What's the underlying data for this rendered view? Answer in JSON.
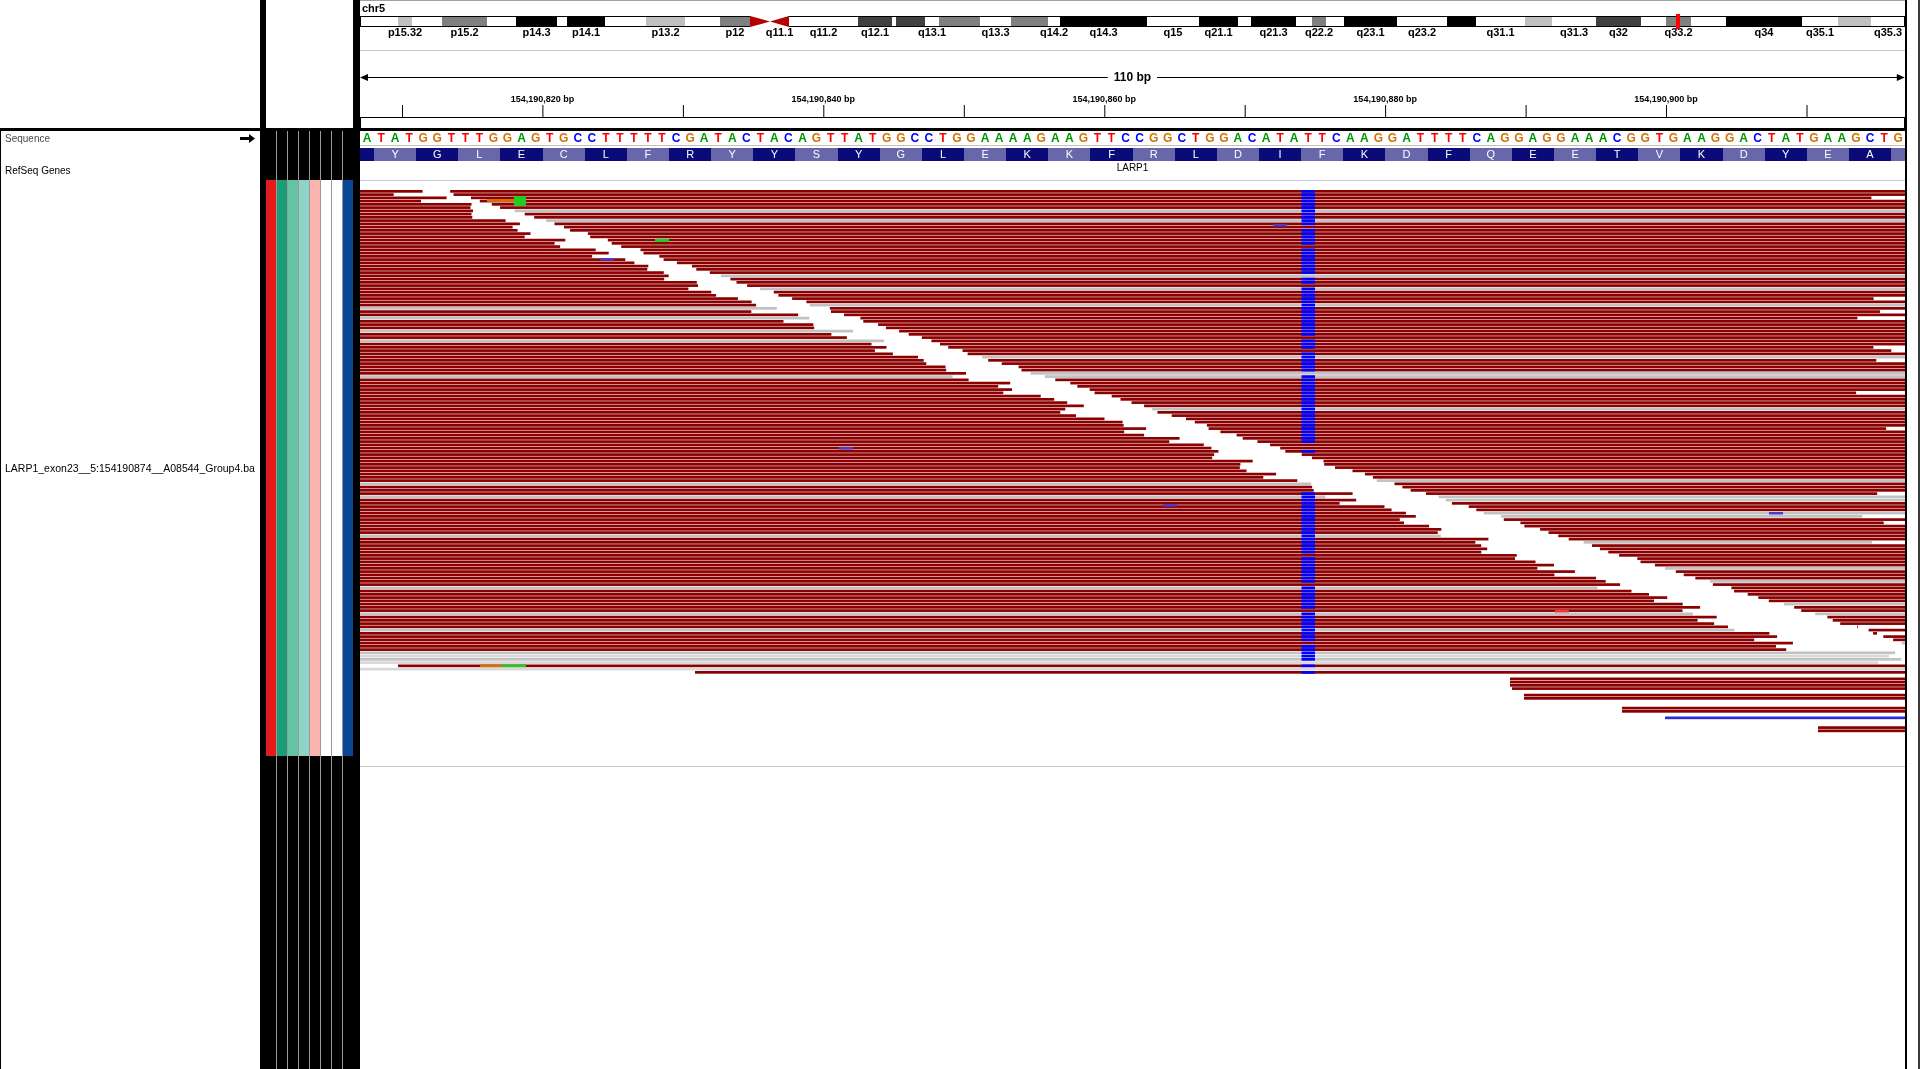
{
  "ideogram": {
    "chromosome": "chr5",
    "bands": [
      {
        "kind": "band",
        "color": "#ffffff",
        "in_view": false
      },
      {
        "kind": "band",
        "label": "p15.32",
        "color": "#c0c0c0",
        "in_view": false
      },
      {
        "kind": "band",
        "color": "#ffffff",
        "in_view": false
      },
      {
        "kind": "band",
        "label": "p15.2",
        "color": "#808080",
        "in_view": false
      },
      {
        "kind": "band",
        "color": "#ffffff",
        "in_view": false
      },
      {
        "kind": "band",
        "label": "p14.3",
        "color": "#000000",
        "in_view": false
      },
      {
        "kind": "band",
        "color": "#ffffff",
        "in_view": false
      },
      {
        "kind": "band",
        "label": "p14.1",
        "color": "#000000",
        "in_view": false
      },
      {
        "kind": "band",
        "color": "#ffffff",
        "in_view": false
      },
      {
        "kind": "band",
        "label": "p13.2",
        "color": "#c0c0c0",
        "in_view": false
      },
      {
        "kind": "band",
        "color": "#ffffff",
        "in_view": false
      },
      {
        "kind": "band",
        "label": "p12",
        "color": "#808080",
        "in_view": false
      },
      {
        "kind": "centromere",
        "color": "#b40000",
        "in_view": false
      },
      {
        "kind": "centromere",
        "label": "q11.1",
        "color": "#b40000",
        "in_view": false
      },
      {
        "kind": "band",
        "label": "q11.2",
        "color": "#ffffff",
        "in_view": false
      },
      {
        "kind": "band",
        "label": "q12.1",
        "color": "#404040",
        "in_view": false
      },
      {
        "kind": "band",
        "color": "#ffffff",
        "in_view": false
      },
      {
        "kind": "band",
        "color": "#404040",
        "in_view": false
      },
      {
        "kind": "band",
        "label": "q13.1",
        "color": "#ffffff",
        "in_view": false
      },
      {
        "kind": "band",
        "color": "#808080",
        "in_view": false
      },
      {
        "kind": "band",
        "label": "q13.3",
        "color": "#ffffff",
        "in_view": false
      },
      {
        "kind": "band",
        "color": "#808080",
        "in_view": false
      },
      {
        "kind": "band",
        "label": "q14.2",
        "color": "#ffffff",
        "in_view": false
      },
      {
        "kind": "band",
        "label": "q14.3",
        "color": "#000000",
        "in_view": false
      },
      {
        "kind": "band",
        "label": "q15",
        "color": "#ffffff",
        "in_view": false
      },
      {
        "kind": "band",
        "label": "q21.1",
        "color": "#000000",
        "in_view": false
      },
      {
        "kind": "band",
        "color": "#ffffff",
        "in_view": false
      },
      {
        "kind": "band",
        "label": "q21.3",
        "color": "#000000",
        "in_view": false
      },
      {
        "kind": "band",
        "color": "#ffffff",
        "in_view": false
      },
      {
        "kind": "band",
        "label": "q22.2",
        "color": "#808080",
        "in_view": false
      },
      {
        "kind": "band",
        "color": "#ffffff",
        "in_view": false
      },
      {
        "kind": "band",
        "label": "q23.1",
        "color": "#000000",
        "in_view": false
      },
      {
        "kind": "band",
        "label": "q23.2",
        "color": "#ffffff",
        "in_view": false
      },
      {
        "kind": "band",
        "color": "#000000",
        "in_view": false
      },
      {
        "kind": "band",
        "label": "q31.1",
        "color": "#ffffff",
        "in_view": false
      },
      {
        "kind": "band",
        "color": "#c0c0c0",
        "in_view": false
      },
      {
        "kind": "band",
        "label": "q31.3",
        "color": "#ffffff",
        "in_view": false
      },
      {
        "kind": "band",
        "label": "q32",
        "color": "#404040",
        "in_view": false
      },
      {
        "kind": "band",
        "color": "#ffffff",
        "in_view": false
      },
      {
        "kind": "band",
        "label": "q33.2",
        "color": "#808080",
        "in_view": true
      },
      {
        "kind": "band",
        "color": "#ffffff",
        "in_view": false
      },
      {
        "kind": "band",
        "label": "q34",
        "color": "#000000",
        "in_view": false
      },
      {
        "kind": "band",
        "label": "q35.1",
        "color": "#ffffff",
        "in_view": false
      },
      {
        "kind": "band",
        "color": "#c0c0c0",
        "in_view": false
      },
      {
        "kind": "band",
        "label": "q35.3",
        "color": "#ffffff",
        "in_view": false
      }
    ]
  },
  "ruler": {
    "span": "110 bp",
    "tick_labels": [
      "154,190,820 bp",
      "154,190,840 bp",
      "154,190,860 bp",
      "154,190,880 bp",
      "154,190,900 bp"
    ]
  },
  "tracks": [
    {
      "kind": "sequence",
      "name": "Sequence",
      "bases": [
        {
          "base": "A",
          "color": "#009600"
        },
        {
          "base": "T",
          "color": "#ff0000"
        },
        {
          "base": "A",
          "color": "#009600"
        },
        {
          "base": "T",
          "color": "#ff0000"
        },
        {
          "base": "G",
          "color": "#d17105"
        },
        {
          "base": "G",
          "color": "#d17105"
        },
        {
          "base": "T",
          "color": "#ff0000"
        },
        {
          "base": "T",
          "color": "#ff0000"
        },
        {
          "base": "T",
          "color": "#ff0000"
        },
        {
          "base": "G",
          "color": "#d17105"
        },
        {
          "base": "G",
          "color": "#d17105"
        },
        {
          "base": "A",
          "color": "#009600"
        },
        {
          "base": "G",
          "color": "#d17105"
        },
        {
          "base": "T",
          "color": "#ff0000"
        },
        {
          "base": "G",
          "color": "#d17105"
        },
        {
          "base": "C",
          "color": "#0000ff"
        },
        {
          "base": "C",
          "color": "#0000ff"
        },
        {
          "base": "T",
          "color": "#ff0000"
        },
        {
          "base": "T",
          "color": "#ff0000"
        },
        {
          "base": "T",
          "color": "#ff0000"
        },
        {
          "base": "T",
          "color": "#ff0000"
        },
        {
          "base": "T",
          "color": "#ff0000"
        },
        {
          "base": "C",
          "color": "#0000ff"
        },
        {
          "base": "G",
          "color": "#d17105"
        },
        {
          "base": "A",
          "color": "#009600"
        },
        {
          "base": "T",
          "color": "#ff0000"
        },
        {
          "base": "A",
          "color": "#009600"
        },
        {
          "base": "C",
          "color": "#0000ff"
        },
        {
          "base": "T",
          "color": "#ff0000"
        },
        {
          "base": "A",
          "color": "#009600"
        },
        {
          "base": "C",
          "color": "#0000ff"
        },
        {
          "base": "A",
          "color": "#009600"
        },
        {
          "base": "G",
          "color": "#d17105"
        },
        {
          "base": "T",
          "color": "#ff0000"
        },
        {
          "base": "T",
          "color": "#ff0000"
        },
        {
          "base": "A",
          "color": "#009600"
        },
        {
          "base": "T",
          "color": "#ff0000"
        },
        {
          "base": "G",
          "color": "#d17105"
        },
        {
          "base": "G",
          "color": "#d17105"
        },
        {
          "base": "C",
          "color": "#0000ff"
        },
        {
          "base": "C",
          "color": "#0000ff"
        },
        {
          "base": "T",
          "color": "#ff0000"
        },
        {
          "base": "G",
          "color": "#d17105"
        },
        {
          "base": "G",
          "color": "#d17105"
        },
        {
          "base": "A",
          "color": "#009600"
        },
        {
          "base": "A",
          "color": "#009600"
        },
        {
          "base": "A",
          "color": "#009600"
        },
        {
          "base": "A",
          "color": "#009600"
        },
        {
          "base": "G",
          "color": "#d17105"
        },
        {
          "base": "A",
          "color": "#009600"
        },
        {
          "base": "A",
          "color": "#009600"
        },
        {
          "base": "G",
          "color": "#d17105"
        },
        {
          "base": "T",
          "color": "#ff0000"
        },
        {
          "base": "T",
          "color": "#ff0000"
        },
        {
          "base": "C",
          "color": "#0000ff"
        },
        {
          "base": "C",
          "color": "#0000ff"
        },
        {
          "base": "G",
          "color": "#d17105"
        },
        {
          "base": "G",
          "color": "#d17105"
        },
        {
          "base": "C",
          "color": "#0000ff"
        },
        {
          "base": "T",
          "color": "#ff0000"
        },
        {
          "base": "G",
          "color": "#d17105"
        },
        {
          "base": "G",
          "color": "#d17105"
        },
        {
          "base": "A",
          "color": "#009600"
        },
        {
          "base": "C",
          "color": "#0000ff"
        },
        {
          "base": "A",
          "color": "#009600"
        },
        {
          "base": "T",
          "color": "#ff0000"
        },
        {
          "base": "A",
          "color": "#009600"
        },
        {
          "base": "T",
          "color": "#ff0000"
        },
        {
          "base": "T",
          "color": "#ff0000"
        },
        {
          "base": "C",
          "color": "#0000ff"
        },
        {
          "base": "A",
          "color": "#009600"
        },
        {
          "base": "A",
          "color": "#009600"
        },
        {
          "base": "G",
          "color": "#d17105"
        },
        {
          "base": "G",
          "color": "#d17105"
        },
        {
          "base": "A",
          "color": "#009600"
        },
        {
          "base": "T",
          "color": "#ff0000"
        },
        {
          "base": "T",
          "color": "#ff0000"
        },
        {
          "base": "T",
          "color": "#ff0000"
        },
        {
          "base": "T",
          "color": "#ff0000"
        },
        {
          "base": "C",
          "color": "#0000ff"
        },
        {
          "base": "A",
          "color": "#009600"
        },
        {
          "base": "G",
          "color": "#d17105"
        },
        {
          "base": "G",
          "color": "#d17105"
        },
        {
          "base": "A",
          "color": "#009600"
        },
        {
          "base": "G",
          "color": "#d17105"
        },
        {
          "base": "G",
          "color": "#d17105"
        },
        {
          "base": "A",
          "color": "#009600"
        },
        {
          "base": "A",
          "color": "#009600"
        },
        {
          "base": "A",
          "color": "#009600"
        },
        {
          "base": "C",
          "color": "#0000ff"
        },
        {
          "base": "G",
          "color": "#d17105"
        },
        {
          "base": "G",
          "color": "#d17105"
        },
        {
          "base": "T",
          "color": "#ff0000"
        },
        {
          "base": "G",
          "color": "#d17105"
        },
        {
          "base": "A",
          "color": "#009600"
        },
        {
          "base": "A",
          "color": "#009600"
        },
        {
          "base": "G",
          "color": "#d17105"
        },
        {
          "base": "G",
          "color": "#d17105"
        },
        {
          "base": "A",
          "color": "#009600"
        },
        {
          "base": "C",
          "color": "#0000ff"
        },
        {
          "base": "T",
          "color": "#ff0000"
        },
        {
          "base": "A",
          "color": "#009600"
        },
        {
          "base": "T",
          "color": "#ff0000"
        },
        {
          "base": "G",
          "color": "#d17105"
        },
        {
          "base": "A",
          "color": "#009600"
        },
        {
          "base": "A",
          "color": "#009600"
        },
        {
          "base": "G",
          "color": "#d17105"
        },
        {
          "base": "C",
          "color": "#0000ff"
        },
        {
          "base": "T",
          "color": "#ff0000"
        },
        {
          "base": "G",
          "color": "#d17105"
        }
      ]
    },
    {
      "kind": "gene",
      "name": "RefSeq Genes",
      "gene": "LARP1",
      "amino_acids": [
        "Y",
        "G",
        "L",
        "E",
        "C",
        "L",
        "F",
        "R",
        "Y",
        "Y",
        "S",
        "Y",
        "G",
        "L",
        "E",
        "K",
        "K",
        "F",
        "R",
        "L",
        "D",
        "I",
        "F",
        "K",
        "D",
        "F",
        "Q",
        "E",
        "E",
        "T",
        "V",
        "K",
        "D",
        "Y",
        "E",
        "A"
      ]
    },
    {
      "kind": "alignment",
      "name": "LARP1_exon23__5:154190874__A08544_Group4.ba",
      "attributes": [
        {
          "color": "#e41a1c"
        },
        {
          "color": "#1b9e77"
        },
        {
          "color": "#66c2a5"
        },
        {
          "color": "#8dd3c7"
        },
        {
          "color": "#fbb4ae"
        },
        {
          "color": "#ffffff"
        },
        {
          "color": "#ffffff"
        },
        {
          "color": "#0b4596"
        }
      ]
    }
  ]
}
